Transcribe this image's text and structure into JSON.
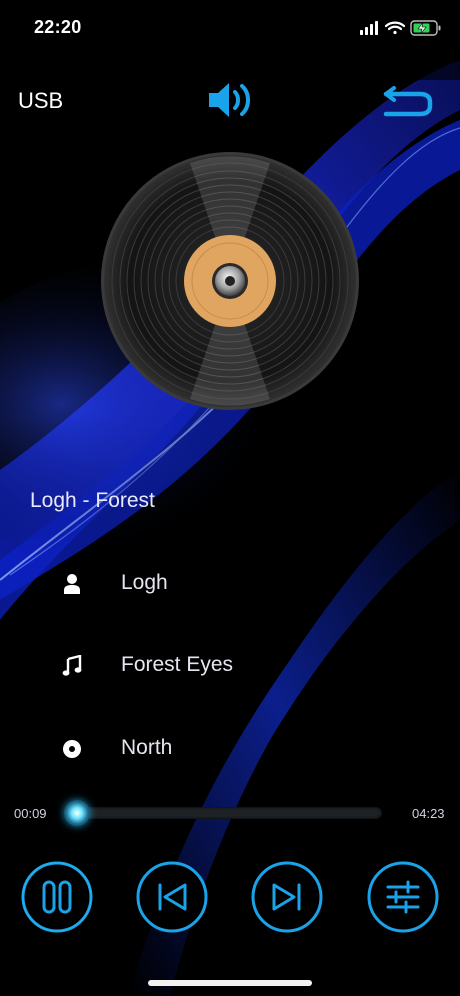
{
  "status_bar": {
    "time": "22:20",
    "icons": [
      "signal-icon",
      "wifi-icon",
      "battery-charging-icon"
    ]
  },
  "header": {
    "source": "USB",
    "volume_icon": "speaker-volume-icon",
    "back_icon": "return-arrow-icon"
  },
  "now_playing": {
    "title": "Logh - Forest",
    "artist": "Logh",
    "album": "Forest Eyes",
    "genre": "North"
  },
  "progress": {
    "current": "00:09",
    "total": "04:23",
    "fraction": 0.034
  },
  "controls": [
    {
      "name": "pause-button",
      "icon": "pause-icon"
    },
    {
      "name": "previous-button",
      "icon": "skip-previous-icon"
    },
    {
      "name": "next-button",
      "icon": "skip-next-icon"
    },
    {
      "name": "equalizer-button",
      "icon": "sliders-icon"
    }
  ],
  "colors": {
    "accent": "#1aa3e8",
    "glow": "#20ccff",
    "label_disc": "#e0a561"
  }
}
